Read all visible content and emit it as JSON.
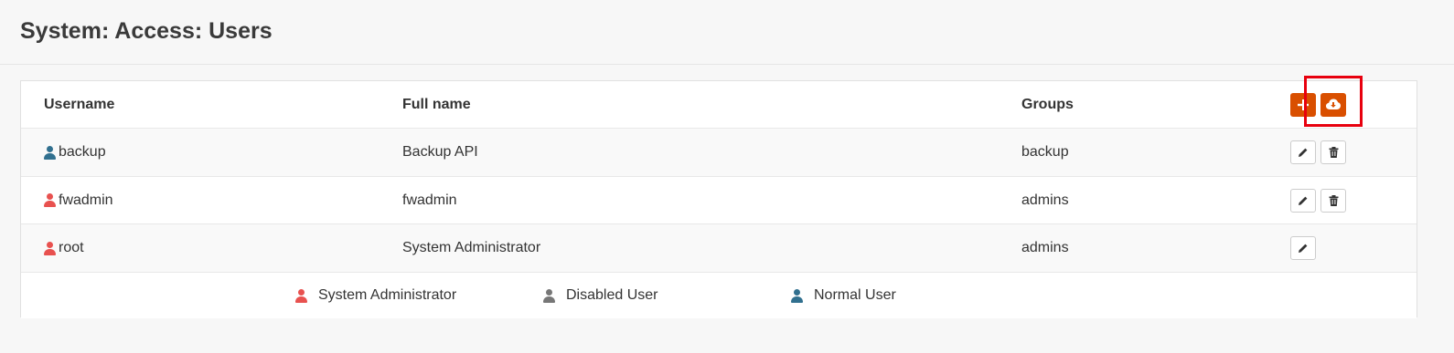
{
  "page": {
    "title": "System: Access: Users"
  },
  "colors": {
    "admin": "#e8514f",
    "disabled": "#777777",
    "normal": "#31708f",
    "accent": "#d94f00",
    "highlight": "#e8000e"
  },
  "table": {
    "headers": {
      "username": "Username",
      "fullname": "Full name",
      "groups": "Groups"
    },
    "actions": {
      "add_icon": "plus-icon",
      "import_icon": "cloud-download-icon"
    },
    "rows": [
      {
        "username": "backup",
        "fullname": "Backup API",
        "groups": "backup",
        "type": "normal",
        "edit": true,
        "delete": true
      },
      {
        "username": "fwadmin",
        "fullname": "fwadmin",
        "groups": "admins",
        "type": "admin",
        "edit": true,
        "delete": true
      },
      {
        "username": "root",
        "fullname": "System Administrator",
        "groups": "admins",
        "type": "admin",
        "edit": true,
        "delete": false
      }
    ]
  },
  "legend": {
    "admin": "System Administrator",
    "disabled": "Disabled User",
    "normal": "Normal User"
  }
}
